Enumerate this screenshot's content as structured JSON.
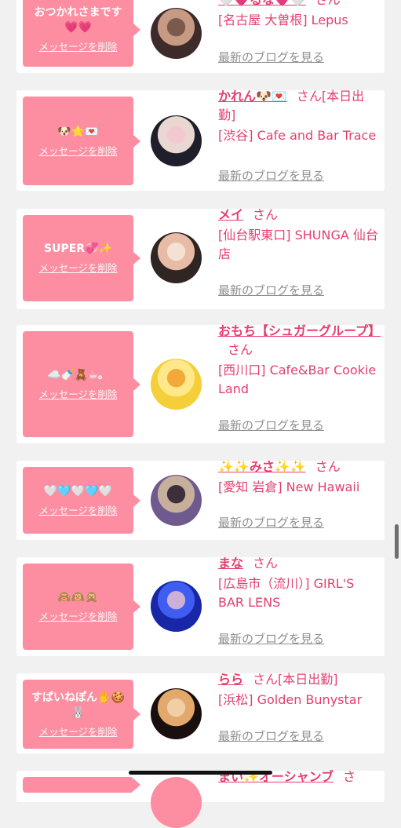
{
  "items": [
    {
      "message": "おつかれさまです💗💗",
      "delete_label": "メッセージを削除",
      "name": "🤍💗るな💗🤍",
      "suffix": "さん",
      "shop": "[名古屋 大曽根] Lepus",
      "blog_label": "最新のブログを見る",
      "avatar": {
        "colors": [
          "#3d2a2a",
          "#c79a84",
          "#7a5a4d"
        ]
      }
    },
    {
      "message": "🐶⭐💌",
      "delete_label": "メッセージを削除",
      "name": "かれん🐶💌",
      "suffix": "さん[本日出勤]",
      "shop": "[渋谷] Cafe and Bar Trace",
      "blog_label": "最新のブログを見る",
      "avatar": {
        "colors": [
          "#1f1f2b",
          "#e9d8d2",
          "#f3c9d0"
        ]
      }
    },
    {
      "message": "SUPER💞✨",
      "delete_label": "メッセージを削除",
      "name": "メイ",
      "suffix": "さん",
      "shop": "[仙台駅東口] SHUNGA 仙台店",
      "blog_label": "最新のブログを見る",
      "avatar": {
        "colors": [
          "#2f2522",
          "#e8bba6",
          "#f5e0d4"
        ]
      }
    },
    {
      "message": "☁️🍼🧸☕。",
      "delete_label": "メッセージを削除",
      "name": "おもち【シュガーグループ】",
      "suffix": "さん",
      "shop": "[西川口] Cafe&Bar Cookie Land",
      "blog_label": "最新のブログを見る",
      "avatar": {
        "colors": [
          "#f5cf3a",
          "#ffe88a",
          "#f2a93a"
        ]
      }
    },
    {
      "message": "🤍🩵🤍🩵🤍",
      "delete_label": "メッセージを削除",
      "name": "✨✨みさ✨✨",
      "suffix": "さん",
      "shop": "[愛知 岩倉] New Hawaii",
      "blog_label": "最新のブログを見る",
      "avatar": {
        "colors": [
          "#6e5a8e",
          "#c7b09b",
          "#3c2e3a"
        ]
      }
    },
    {
      "message": "🙈🙉🙊",
      "delete_label": "メッセージを削除",
      "name": "まな",
      "suffix": "さん",
      "shop": "[広島市（流川）] GIRL'S BAR LENS",
      "blog_label": "最新のブログを見る",
      "avatar": {
        "colors": [
          "#1727a8",
          "#3f5df0",
          "#cdb0d8"
        ]
      }
    },
    {
      "message": "すぱいねぽん🖐️🍪🐰",
      "delete_label": "メッセージを削除",
      "name": "らら",
      "suffix": "さん[本日出勤]",
      "shop": "[浜松] Golden Bunystar",
      "blog_label": "最新のブログを見る",
      "avatar": {
        "colors": [
          "#1a0f0f",
          "#e3a86b",
          "#f0cfa6"
        ]
      }
    },
    {
      "message": "",
      "delete_label": "",
      "name": "まい✨オーシャンブ",
      "suffix": "さ",
      "shop": "",
      "blog_label": "",
      "avatar": {
        "colors": [
          "#fd8ea1",
          "#fd8ea1",
          "#fd8ea1"
        ]
      }
    }
  ]
}
